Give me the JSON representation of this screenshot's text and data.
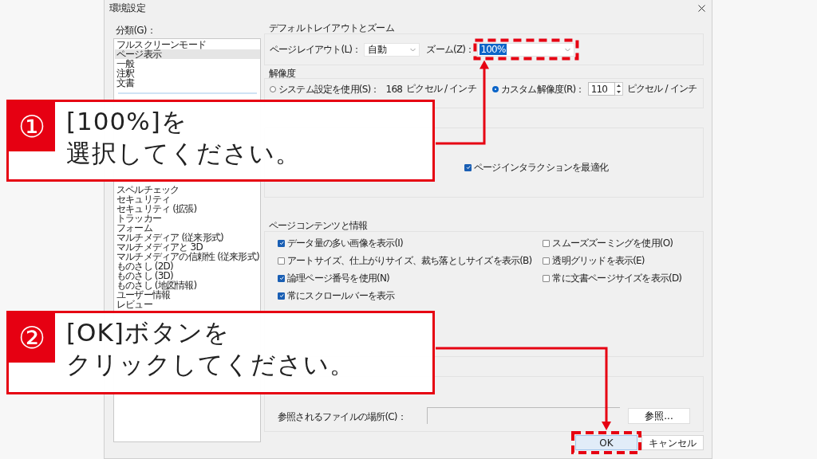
{
  "window": {
    "title": "環境設定"
  },
  "categories": {
    "label": "分類(G)：",
    "top_items": [
      {
        "label": "フルスクリーンモード",
        "selected": false
      },
      {
        "label": "ページ表示",
        "selected": true
      },
      {
        "label": "一般",
        "selected": false
      },
      {
        "label": "注釈",
        "selected": false
      },
      {
        "label": "文書",
        "selected": false
      }
    ],
    "items": [
      {
        "label": "スペルチェック",
        "selected": false
      },
      {
        "label": "セキュリティ",
        "selected": false
      },
      {
        "label": "セキュリティ (拡張)",
        "selected": false
      },
      {
        "label": "トラッカー",
        "selected": false
      },
      {
        "label": "フォーム",
        "selected": false
      },
      {
        "label": "マルチメディア (従来形式)",
        "selected": false
      },
      {
        "label": "マルチメディアと 3D",
        "selected": false
      },
      {
        "label": "マルチメディアの信頼性 (従来形式)",
        "selected": false
      },
      {
        "label": "ものさし (2D)",
        "selected": false
      },
      {
        "label": "ものさし (3D)",
        "selected": false
      },
      {
        "label": "ものさし (地図情報)",
        "selected": false
      },
      {
        "label": "ユーザー情報",
        "selected": false
      },
      {
        "label": "レビュー",
        "selected": false
      }
    ]
  },
  "layout_zoom": {
    "title": "デフォルトレイアウトとズーム",
    "page_layout_label": "ページレイアウト(L)：",
    "page_layout_value": "自動",
    "zoom_label": "ズーム(Z)：",
    "zoom_value": "100%",
    "zoom_text_selected": true
  },
  "resolution": {
    "title": "解像度",
    "options": [
      {
        "kind": "readout",
        "label": "システム設定を使用(S)：",
        "selected": false,
        "value": "168",
        "unit": "ピクセル / インチ"
      },
      {
        "kind": "spinner",
        "label": "カスタム解像度(R)：",
        "selected": true,
        "value": "110",
        "unit": "ピクセル / インチ"
      }
    ]
  },
  "rendering": {
    "checkboxes": [
      {
        "label": "ページインタラクションを最適化",
        "checked": true
      }
    ]
  },
  "page_content": {
    "title": "ページコンテンツと情報",
    "checkboxes": [
      {
        "label": "データ量の多い画像を表示(I)",
        "checked": true
      },
      {
        "label": "スムーズズーミングを使用(O)",
        "checked": false
      },
      {
        "label": "アートサイズ、仕上がりサイズ、裁ち落としサイズを表示(B)",
        "checked": false
      },
      {
        "label": "透明グリッドを表示(E)",
        "checked": false
      },
      {
        "label": "論理ページ番号を使用(N)",
        "checked": true
      },
      {
        "label": "常に文書ページサイズを表示(D)",
        "checked": false
      },
      {
        "label": "常にスクロールバーを表示",
        "checked": true
      }
    ]
  },
  "reference": {
    "location_label": "参照されるファイルの場所(C)：",
    "browse_button": "参照..."
  },
  "buttons": [
    {
      "label": "OK",
      "kind": "primary"
    },
    {
      "label": "キャンセル",
      "kind": "normal"
    }
  ],
  "callouts": [
    {
      "number": "①",
      "lines": [
        "[100%]を",
        "選択してください。"
      ]
    },
    {
      "number": "②",
      "lines": [
        "[OK]ボタンを",
        "クリックしてください。"
      ]
    }
  ]
}
